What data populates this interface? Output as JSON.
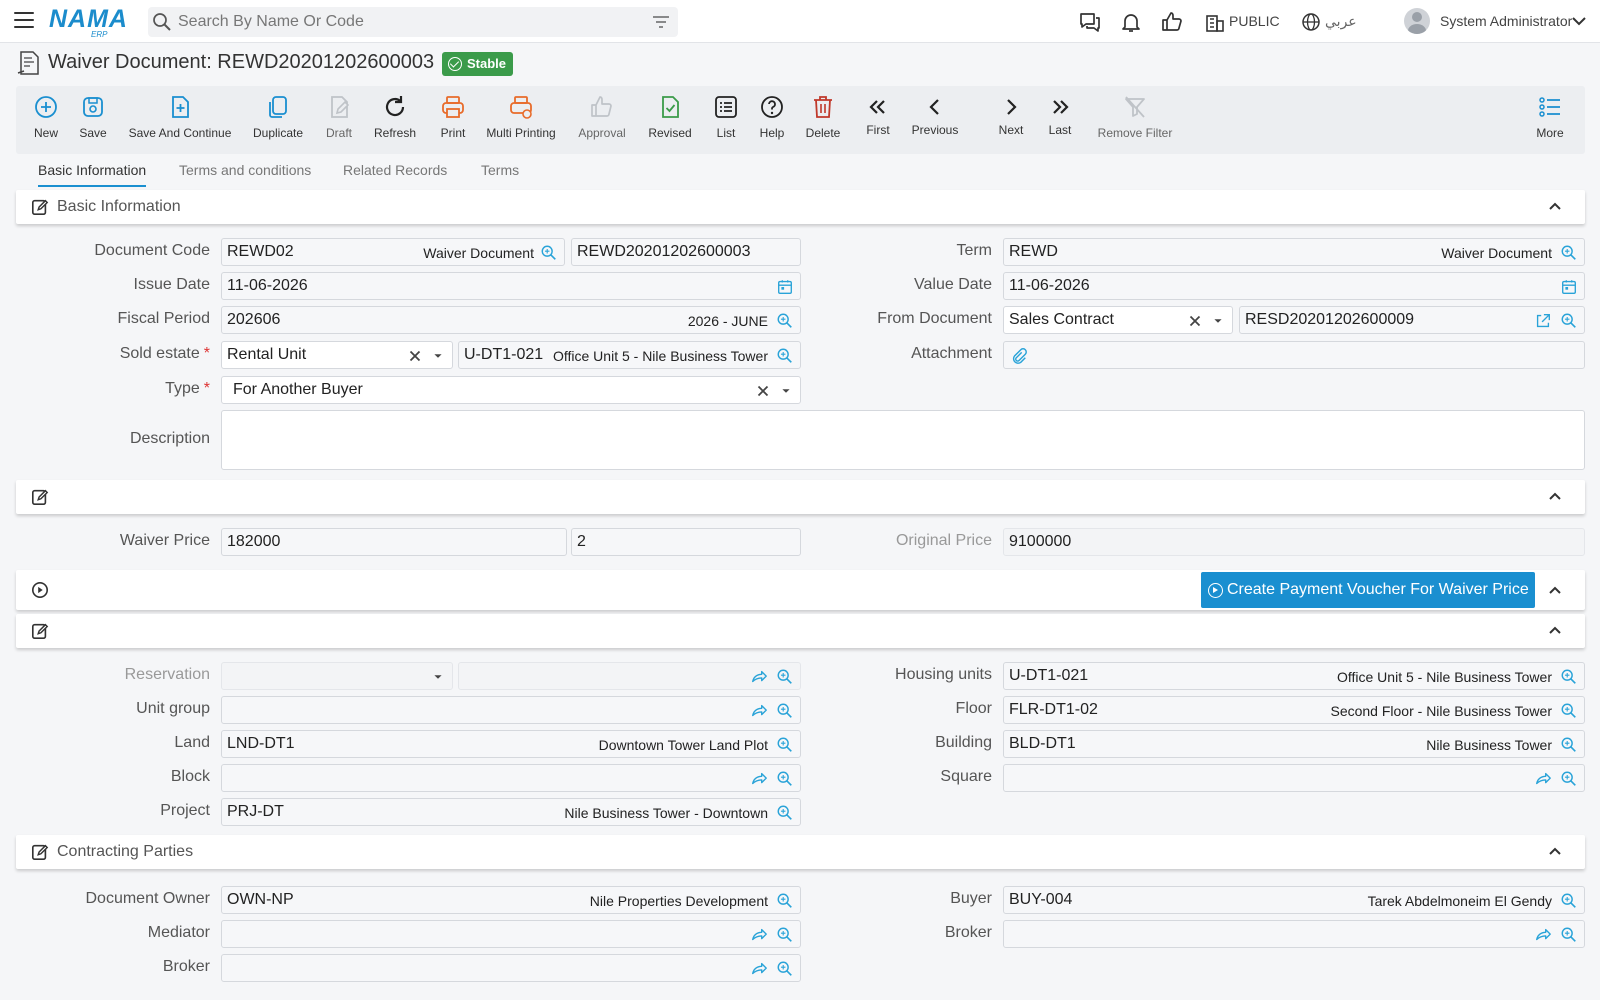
{
  "header": {
    "logo": "NAMA",
    "logo_sub": "ERP",
    "search_placeholder": "Search By Name Or Code",
    "public_label": "PUBLIC",
    "language_label": "عربي",
    "user_name": "System Administrator"
  },
  "page": {
    "title": "Waiver Document: REWD20201202600003",
    "status": "Stable",
    "status_color": "#3b9b4a"
  },
  "toolbar": {
    "new": "New",
    "save": "Save",
    "save_continue": "Save And Continue",
    "duplicate": "Duplicate",
    "draft": "Draft",
    "refresh": "Refresh",
    "print": "Print",
    "multi_printing": "Multi Printing",
    "approval": "Approval",
    "revised": "Revised",
    "list": "List",
    "help": "Help",
    "delete": "Delete",
    "first": "First",
    "previous": "Previous",
    "next": "Next",
    "last": "Last",
    "remove_filter": "Remove Filter",
    "more": "More"
  },
  "tabs": [
    "Basic Information",
    "Terms and conditions",
    "Related Records",
    "Terms"
  ],
  "basic": {
    "section_title": "Basic Information",
    "document_code": {
      "label": "Document Code",
      "value": "REWD02",
      "desc": "Waiver Document",
      "code": "REWD20201202600003"
    },
    "issue_date": {
      "label": "Issue Date",
      "value": "11-06-2026"
    },
    "fiscal_period": {
      "label": "Fiscal Period",
      "value": "202606",
      "desc": "2026 - JUNE"
    },
    "sold_estate": {
      "label": "Sold estate",
      "value": "Rental Unit",
      "code": "U-DT1-021",
      "desc": "Office Unit 5 - Nile Business Tower"
    },
    "type": {
      "label": "Type",
      "value": "For Another Buyer"
    },
    "description": {
      "label": "Description",
      "value": ""
    },
    "term": {
      "label": "Term",
      "value": "REWD",
      "desc": "Waiver Document"
    },
    "value_date": {
      "label": "Value Date",
      "value": "11-06-2026"
    },
    "from_document": {
      "label": "From Document",
      "value": "Sales Contract",
      "code": "RESD20201202600009"
    },
    "attachment": {
      "label": "Attachment"
    }
  },
  "price": {
    "waiver_price": {
      "label": "Waiver Price",
      "value": "182000",
      "percent": "2"
    },
    "original_price": {
      "label": "Original Price",
      "value": "9100000"
    },
    "payment_button": "Create Payment Voucher For Waiver Price"
  },
  "unit": {
    "reservation": {
      "label": "Reservation"
    },
    "unit_group": {
      "label": "Unit group"
    },
    "land": {
      "label": "Land",
      "value": "LND-DT1",
      "desc": "Downtown Tower Land Plot"
    },
    "block": {
      "label": "Block"
    },
    "project": {
      "label": "Project",
      "value": "PRJ-DT",
      "desc": "Nile Business Tower - Downtown"
    },
    "housing_units": {
      "label": "Housing units",
      "value": "U-DT1-021",
      "desc": "Office Unit 5 - Nile Business Tower"
    },
    "floor": {
      "label": "Floor",
      "value": "FLR-DT1-02",
      "desc": "Second Floor - Nile Business Tower"
    },
    "building": {
      "label": "Building",
      "value": "BLD-DT1",
      "desc": "Nile Business Tower"
    },
    "square": {
      "label": "Square"
    }
  },
  "parties": {
    "section_title": "Contracting Parties",
    "document_owner": {
      "label": "Document Owner",
      "value": "OWN-NP",
      "desc": "Nile Properties Development"
    },
    "mediator": {
      "label": "Mediator"
    },
    "broker_left": {
      "label": "Broker"
    },
    "buyer": {
      "label": "Buyer",
      "value": "BUY-004",
      "desc": "Tarek Abdelmoneim El Gendy"
    },
    "broker_right": {
      "label": "Broker"
    }
  }
}
